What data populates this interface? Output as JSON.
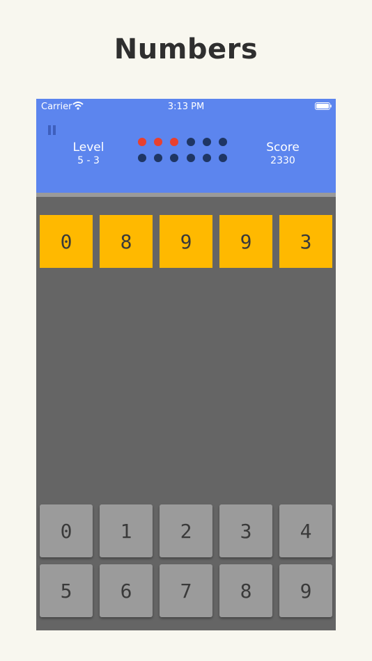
{
  "page_title": "Numbers",
  "status_bar": {
    "carrier": "Carrier",
    "time": "3:13 PM"
  },
  "header": {
    "level_label": "Level",
    "level_value": "5 - 3",
    "score_label": "Score",
    "score_value": "2330",
    "pause_icon": "pause-icon"
  },
  "progress_dots": {
    "total": 12,
    "filled": 3,
    "filled_color": "#e8402f",
    "empty_color": "#1f3664"
  },
  "sequence": [
    "0",
    "8",
    "9",
    "9",
    "3"
  ],
  "keypad": [
    "0",
    "1",
    "2",
    "3",
    "4",
    "5",
    "6",
    "7",
    "8",
    "9"
  ],
  "colors": {
    "header": "#5c85ee",
    "tile": "#ffb900",
    "key": "#9b9b9b",
    "board": "#656565",
    "background": "#f8f7ef"
  }
}
